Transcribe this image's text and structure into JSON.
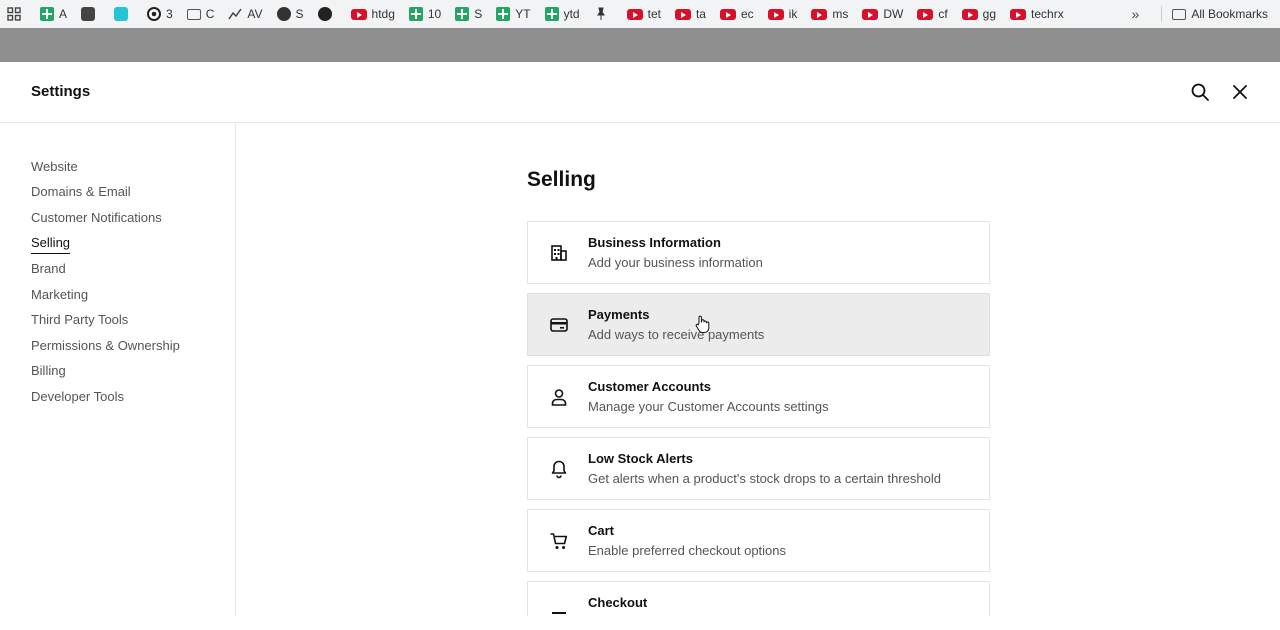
{
  "bookmarks": [
    {
      "icon": "apps-grid-icon",
      "label": ""
    },
    {
      "icon": "sheets-icon",
      "label": "A"
    },
    {
      "icon": "puzzle-icon",
      "label": ""
    },
    {
      "icon": "cyan-app-icon",
      "label": ""
    },
    {
      "icon": "ring-icon",
      "label": "3"
    },
    {
      "icon": "folder-icon",
      "label": "C"
    },
    {
      "icon": "trend-icon",
      "label": "AV"
    },
    {
      "icon": "globe-icon",
      "label": "S"
    },
    {
      "icon": "github-icon",
      "label": ""
    },
    {
      "icon": "youtube-icon",
      "label": "htdg"
    },
    {
      "icon": "sheets-icon",
      "label": "10"
    },
    {
      "icon": "sheets-icon",
      "label": "S"
    },
    {
      "icon": "sheets-icon",
      "label": "YT"
    },
    {
      "icon": "sheets-icon",
      "label": "ytd"
    },
    {
      "icon": "pin-icon",
      "label": ""
    },
    {
      "icon": "youtube-icon",
      "label": "tet"
    },
    {
      "icon": "youtube-icon",
      "label": "ta"
    },
    {
      "icon": "youtube-icon",
      "label": "ec"
    },
    {
      "icon": "youtube-icon",
      "label": "ik"
    },
    {
      "icon": "youtube-icon",
      "label": "ms"
    },
    {
      "icon": "youtube-icon",
      "label": "DW"
    },
    {
      "icon": "youtube-icon",
      "label": "cf"
    },
    {
      "icon": "youtube-icon",
      "label": "gg"
    },
    {
      "icon": "youtube-icon",
      "label": "techrx"
    }
  ],
  "bookmarks_more": "»",
  "all_bookmarks": "All Bookmarks",
  "header": {
    "title": "Settings"
  },
  "sidebar": {
    "items": [
      {
        "label": "Website",
        "active": false
      },
      {
        "label": "Domains & Email",
        "active": false
      },
      {
        "label": "Customer Notifications",
        "active": false
      },
      {
        "label": "Selling",
        "active": true
      },
      {
        "label": "Brand",
        "active": false
      },
      {
        "label": "Marketing",
        "active": false
      },
      {
        "label": "Third Party Tools",
        "active": false
      },
      {
        "label": "Permissions & Ownership",
        "active": false
      },
      {
        "label": "Billing",
        "active": false
      },
      {
        "label": "Developer Tools",
        "active": false
      }
    ]
  },
  "main": {
    "title": "Selling",
    "cards": [
      {
        "icon": "building-icon",
        "title": "Business Information",
        "desc": "Add your business information",
        "hover": false
      },
      {
        "icon": "credit-card-icon",
        "title": "Payments",
        "desc": "Add ways to receive payments",
        "hover": true
      },
      {
        "icon": "person-icon",
        "title": "Customer Accounts",
        "desc": "Manage your Customer Accounts settings",
        "hover": false
      },
      {
        "icon": "bell-icon",
        "title": "Low Stock Alerts",
        "desc": "Get alerts when a product's stock drops to a certain threshold",
        "hover": false
      },
      {
        "icon": "cart-icon",
        "title": "Cart",
        "desc": "Enable preferred checkout options",
        "hover": false
      },
      {
        "icon": "checkout-icon",
        "title": "Checkout",
        "desc": "",
        "hover": false
      }
    ]
  }
}
